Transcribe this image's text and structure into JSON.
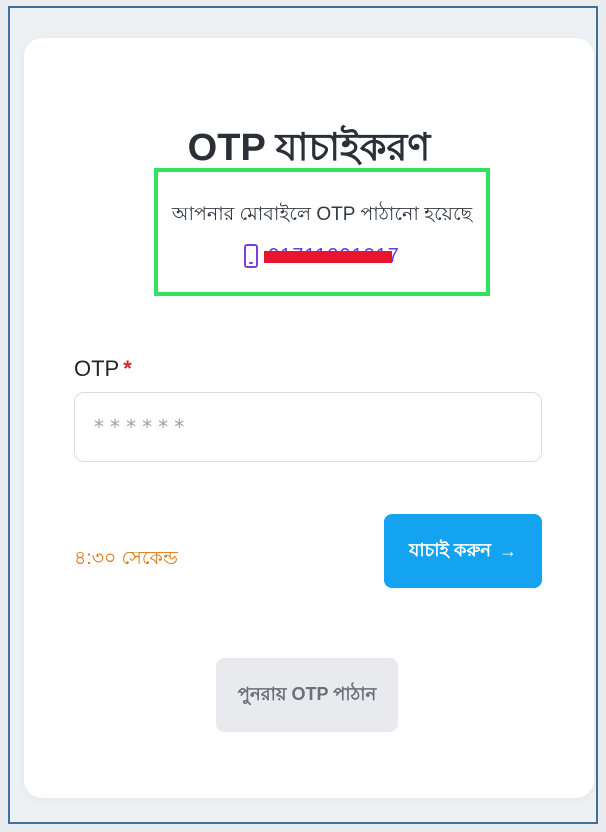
{
  "card": {
    "title": "OTP যাচাইকরণ",
    "sent_message": "আপনার মোবাইলে OTP পাঠানো হয়েছে",
    "phone_number": "01711201017"
  },
  "form": {
    "otp_label": "OTP",
    "required_mark": "*",
    "otp_placeholder": "******",
    "otp_value": ""
  },
  "timer": {
    "text": "৪:৩০ সেকেন্ড"
  },
  "buttons": {
    "verify_label": "যাচাই করুন",
    "verify_arrow": "→",
    "resend_label": "পুনরায় OTP পাঠান"
  },
  "colors": {
    "primary": "#14a3f1",
    "timer": "#d97810",
    "highlight_box": "#2fe35b",
    "redaction": "#e8152f",
    "phone_accent": "#6a3ed8"
  }
}
